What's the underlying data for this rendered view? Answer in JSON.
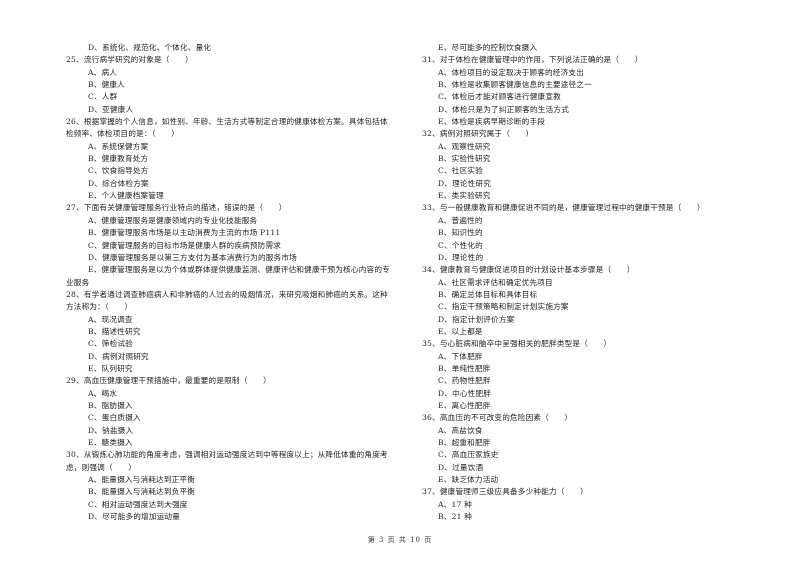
{
  "page": {
    "footer": "第 3 页 共 10 页"
  },
  "left_column": [
    {
      "type": "opt",
      "text": "D、系统化、规范化、个体化、量化"
    },
    {
      "type": "q",
      "text": "25、流行病学研究的对象是（　　）"
    },
    {
      "type": "opt",
      "text": "A、病人"
    },
    {
      "type": "opt",
      "text": "B、健康人"
    },
    {
      "type": "opt",
      "text": "C、人群"
    },
    {
      "type": "opt",
      "text": "D、亚健康人"
    },
    {
      "type": "q",
      "text": "26、根据掌握的个人信息，如性别、年龄、生活方式等制定合理的健康体检方案。具体包括体"
    },
    {
      "type": "q",
      "text": "检频率、体检项目的是：（　　）"
    },
    {
      "type": "opt",
      "text": "A、系统保健方案"
    },
    {
      "type": "opt",
      "text": "B、健康教育处方"
    },
    {
      "type": "opt",
      "text": "C、饮食指导处方"
    },
    {
      "type": "opt",
      "text": "D、综合体检方案"
    },
    {
      "type": "opt",
      "text": "E、个人健康档案管理"
    },
    {
      "type": "q",
      "text": "27、下面有关健康管理服务行业特点的描述，错误的是（　　）"
    },
    {
      "type": "opt",
      "text": "A、健康管理服务是健康领域内的专业化技能服务"
    },
    {
      "type": "opt",
      "text": "B、健康管理服务市场是以主动消费为主流的市场 P111"
    },
    {
      "type": "opt",
      "text": "C、健康管理服务的目标市场是健康人群的疾病预防需求"
    },
    {
      "type": "opt",
      "text": "D、健康管理服务是以第三方支付为基本消费行为的服务市场"
    },
    {
      "type": "opt",
      "text": "E、健康管理服务是以为个体或群体提供健康监测、健康评估和健康干预为核心内容的专"
    },
    {
      "type": "q",
      "text": "业服务"
    },
    {
      "type": "q",
      "text": "28、有学者通过调查肺癌病人和非肺癌的人过去的吸烟情况，来研究吸烟和肺癌的关系。这种"
    },
    {
      "type": "q",
      "text": "方法称为：（　　）"
    },
    {
      "type": "opt",
      "text": "A、现况调查"
    },
    {
      "type": "opt",
      "text": "B、描述性研究"
    },
    {
      "type": "opt",
      "text": "C、筛检试验"
    },
    {
      "type": "opt",
      "text": "D、病例对照研究"
    },
    {
      "type": "opt",
      "text": "E、队列研究"
    },
    {
      "type": "q",
      "text": "29、高血压健康管理干预措施中，最重要的是限制（　　）"
    },
    {
      "type": "opt",
      "text": "A、喝水"
    },
    {
      "type": "opt",
      "text": "B、脂肪摄入"
    },
    {
      "type": "opt",
      "text": "C、蛋白质摄入"
    },
    {
      "type": "opt",
      "text": "D、钠盐摄入"
    },
    {
      "type": "opt",
      "text": "E、糖类摄入"
    },
    {
      "type": "q",
      "text": "30、从锻炼心肺功能的角度考虑，强调相对运动强度达到中等程度以上；从降低体重的角度考"
    },
    {
      "type": "q",
      "text": "虑，则强调（　　）"
    },
    {
      "type": "opt",
      "text": "A、能量摄入与消耗达到正平衡"
    },
    {
      "type": "opt",
      "text": "B、能量摄入与消耗达到负平衡"
    },
    {
      "type": "opt",
      "text": "C、相对运动强度达到大强度"
    },
    {
      "type": "opt",
      "text": "D、尽可能多的增加运动量"
    }
  ],
  "right_column": [
    {
      "type": "opt",
      "text": "E、尽可能多的控制饮食摄入"
    },
    {
      "type": "q",
      "text": "31、对于体检在健康管理中的作用，下列说法正确的是（　　）"
    },
    {
      "type": "opt",
      "text": "A、体检项目的设定取决于顾客的经济支出"
    },
    {
      "type": "opt",
      "text": "B、体检是收集顾客健康信息的主要途径之一"
    },
    {
      "type": "opt",
      "text": "C、体检后才能对顾客进行健康宣教"
    },
    {
      "type": "opt",
      "text": "D、体检只是为了纠正顾客的生活方式"
    },
    {
      "type": "opt",
      "text": "E、体检是疾病早期诊断的手段"
    },
    {
      "type": "q",
      "text": "32、病例对照研究属于（　　）"
    },
    {
      "type": "opt",
      "text": "A、观察性研究"
    },
    {
      "type": "opt",
      "text": "B、实验性研究"
    },
    {
      "type": "opt",
      "text": "C、社区实验"
    },
    {
      "type": "opt",
      "text": "D、理论性研究"
    },
    {
      "type": "opt",
      "text": "E、类实验研究"
    },
    {
      "type": "q",
      "text": "33、与一般健康教育和健康促进不同的是，健康管理过程中的健康干预是（　　）"
    },
    {
      "type": "opt",
      "text": "A、普遍性的"
    },
    {
      "type": "opt",
      "text": "B、知识性的"
    },
    {
      "type": "opt",
      "text": "C、个性化的"
    },
    {
      "type": "opt",
      "text": "D、理论性的"
    },
    {
      "type": "q",
      "text": "34、健康教育与健康促进项目的计划设计基本步骤是（　　）"
    },
    {
      "type": "opt",
      "text": "A、社区需求评估和确定优先项目"
    },
    {
      "type": "opt",
      "text": "B、确定总体目标和具体目标"
    },
    {
      "type": "opt",
      "text": "C、指定干预策略和制定计划实施方案"
    },
    {
      "type": "opt",
      "text": "D、指定计划评价方案"
    },
    {
      "type": "opt",
      "text": "E、以上都是"
    },
    {
      "type": "q",
      "text": "35、与心脏病和脑卒中呈强相关的肥胖类型是（　　）"
    },
    {
      "type": "opt",
      "text": "A、下体肥胖"
    },
    {
      "type": "opt",
      "text": "B、单纯性肥胖"
    },
    {
      "type": "opt",
      "text": "C、药物性肥胖"
    },
    {
      "type": "opt",
      "text": "D、中心性肥胖"
    },
    {
      "type": "opt",
      "text": "E、离心性肥胖"
    },
    {
      "type": "q",
      "text": "36、高血压的不可改变的危险因素（　　）"
    },
    {
      "type": "opt",
      "text": "A、高盐饮食"
    },
    {
      "type": "opt",
      "text": "B、超重和肥胖"
    },
    {
      "type": "opt",
      "text": "C、高血压家族史"
    },
    {
      "type": "opt",
      "text": "D、过量饮酒"
    },
    {
      "type": "opt",
      "text": "E、缺乏体力活动"
    },
    {
      "type": "q",
      "text": "37、健康管理师三级应具备多少种能力（　　）"
    },
    {
      "type": "opt",
      "text": "A、17 种"
    },
    {
      "type": "opt",
      "text": "B、21 种"
    }
  ]
}
